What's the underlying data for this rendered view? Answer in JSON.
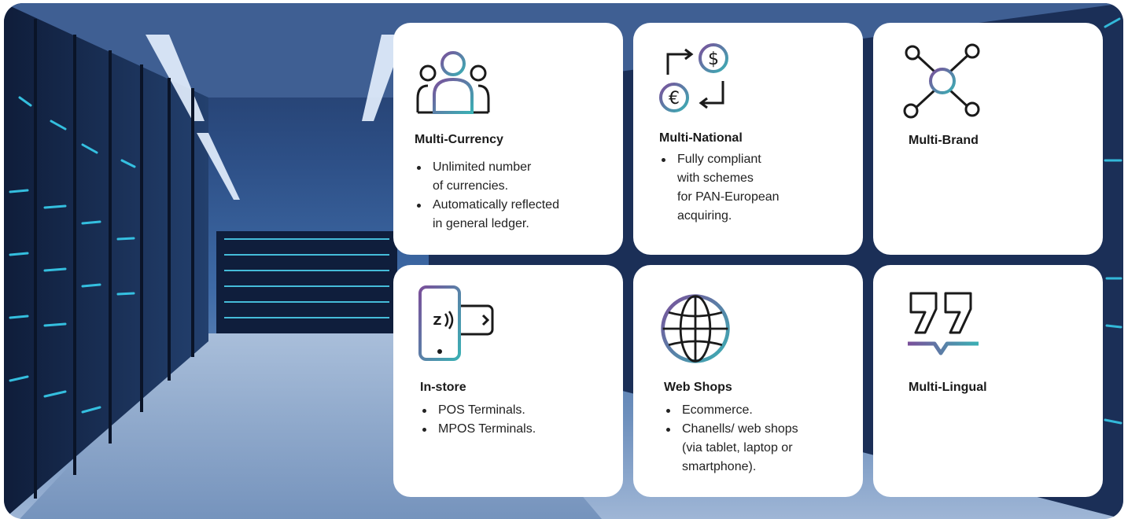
{
  "colors": {
    "accent_start": "#7a4f9a",
    "accent_end": "#3ab0b4",
    "icon_stroke": "#1a1a1a"
  },
  "cards": [
    {
      "title": "Multi-Currency",
      "icon": "people-group-icon",
      "bullets": [
        "Unlimited number\nof currencies.",
        "Automatically reflected\nin general ledger."
      ]
    },
    {
      "title": "Multi-National",
      "icon": "currency-exchange-icon",
      "bullets": [
        "Fully compliant\nwith schemes\nfor PAN-European\nacquiring."
      ]
    },
    {
      "title": "Multi-Brand",
      "icon": "network-node-icon",
      "bullets": []
    },
    {
      "title": "In-store",
      "icon": "contactless-phone-card-icon",
      "bullets": [
        "POS Terminals.",
        "MPOS Terminals."
      ]
    },
    {
      "title": "Web Shops",
      "icon": "globe-icon",
      "bullets": [
        "Ecommerce.",
        "Chanells/ web shops\n(via tablet, laptop or\nsmartphone)."
      ]
    },
    {
      "title": "Multi-Lingual",
      "icon": "quote-speech-icon",
      "bullets": []
    }
  ]
}
